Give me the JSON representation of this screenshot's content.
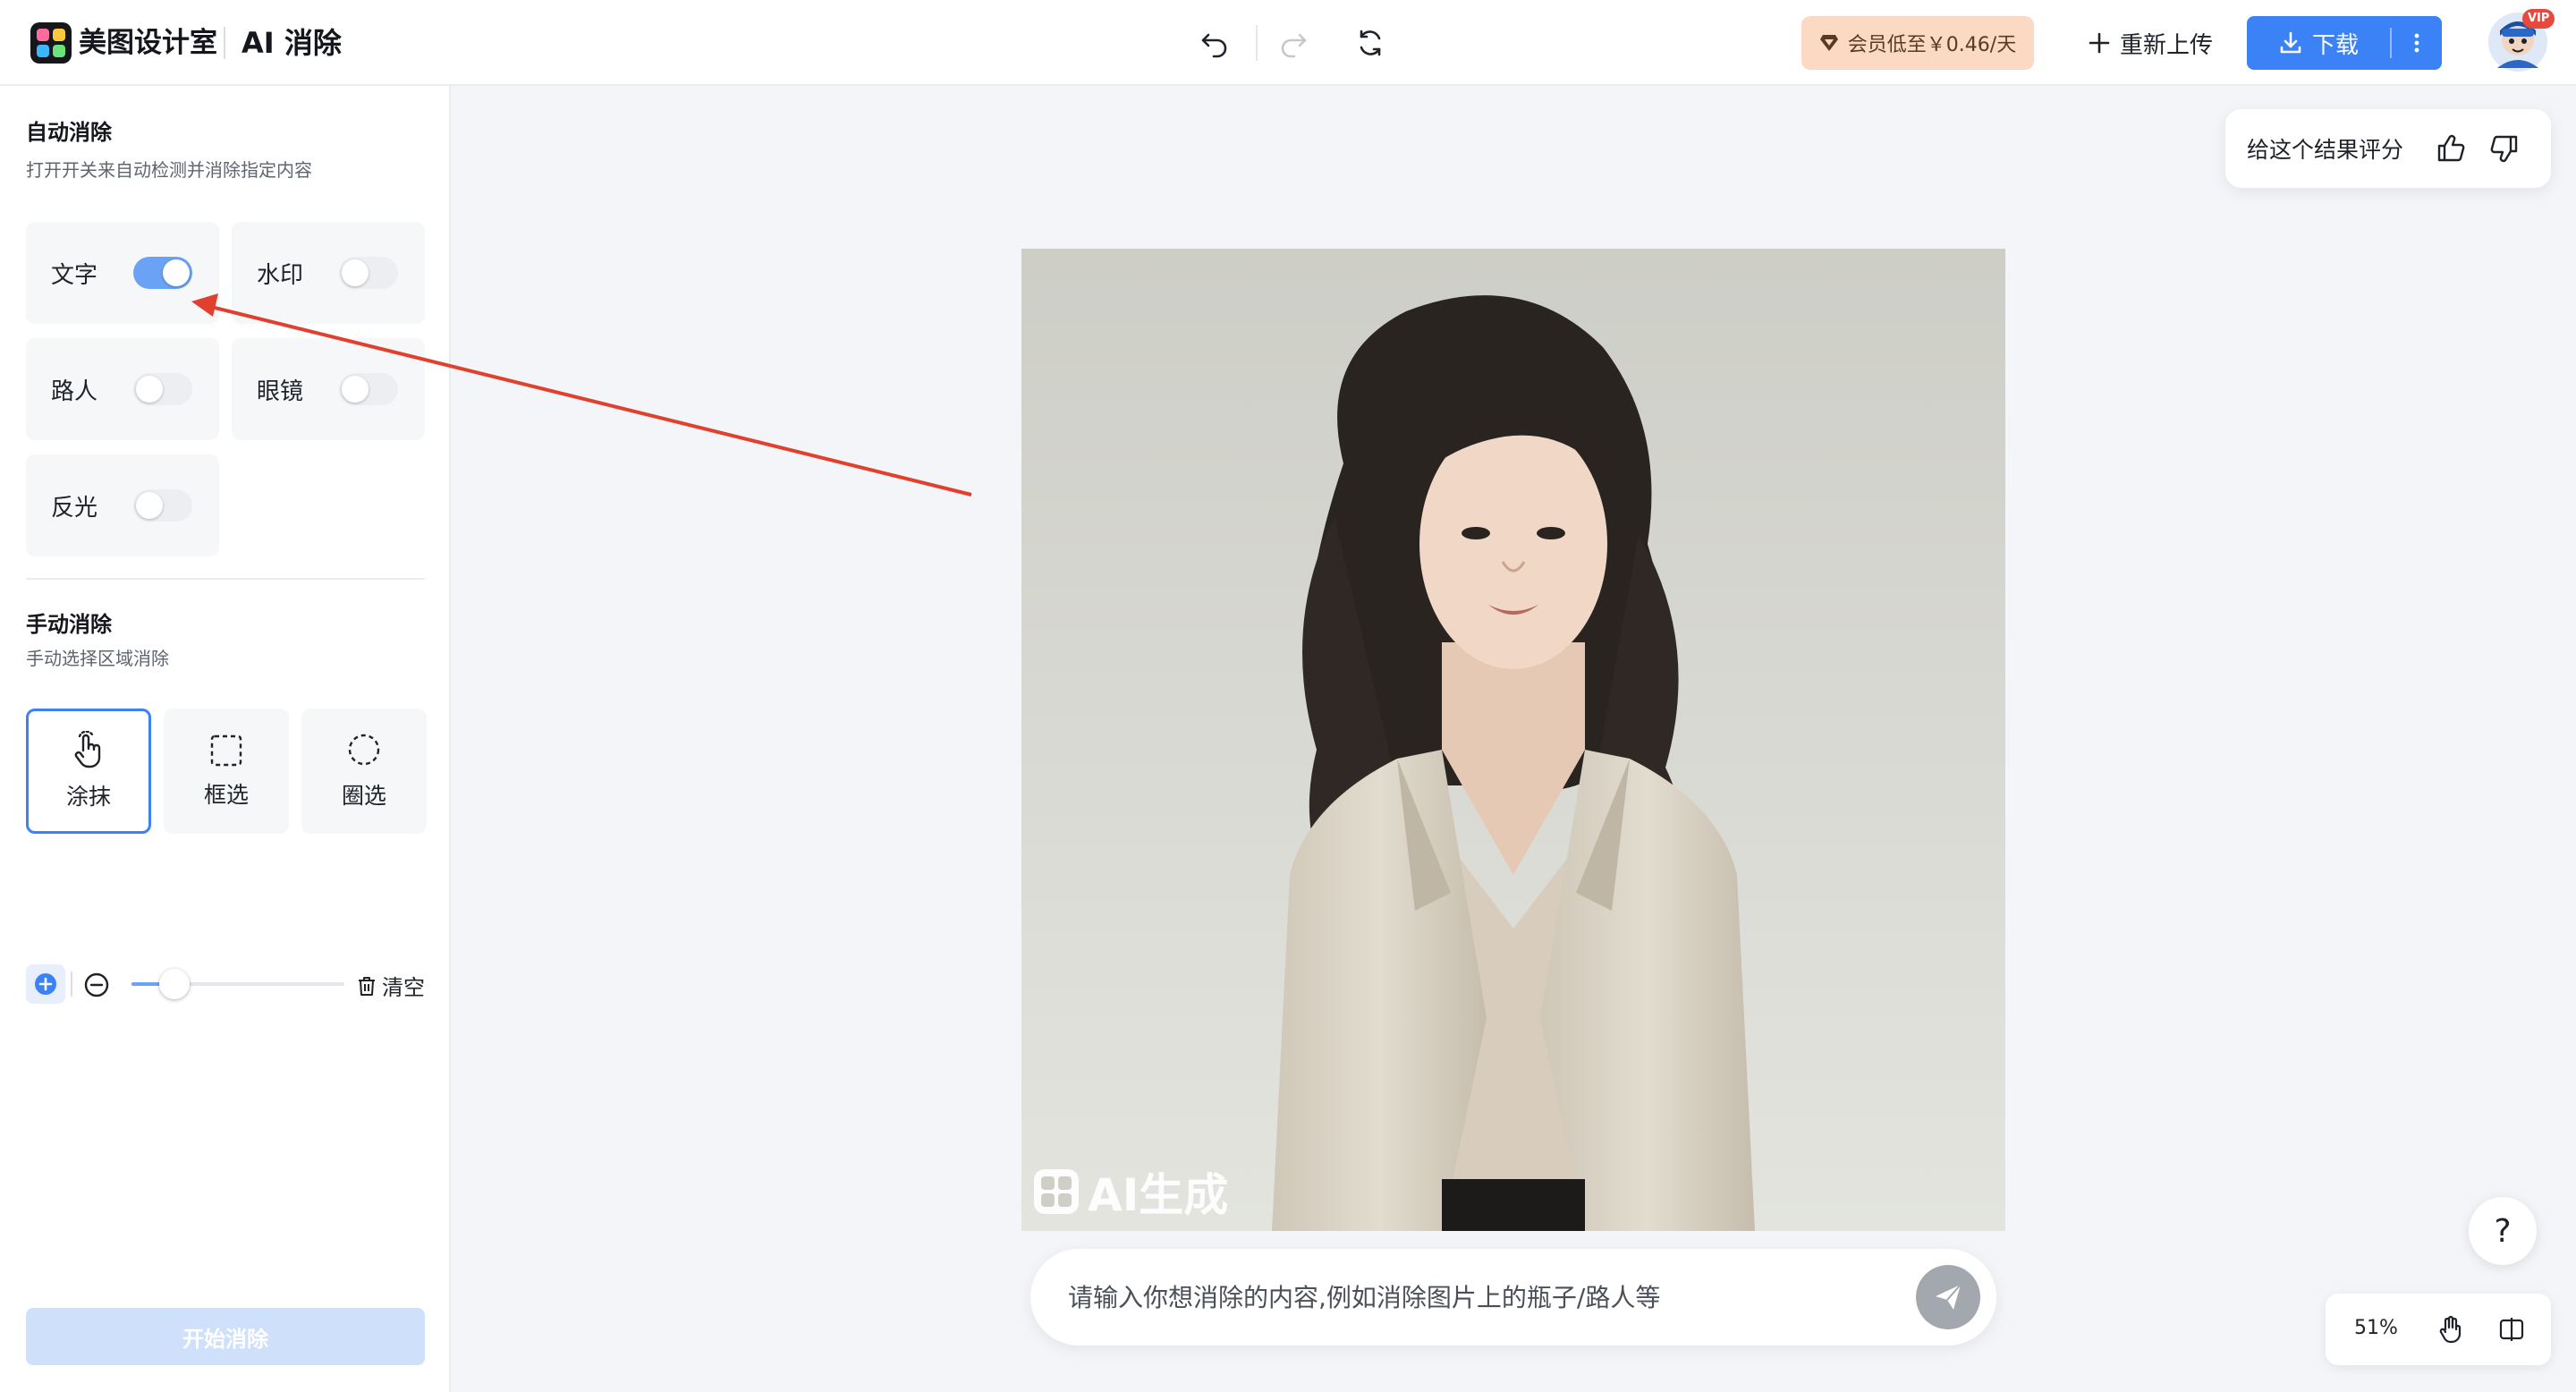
{
  "header": {
    "brand": "美图设计室",
    "tool_title": "AI 消除",
    "vip_offer": "会员低至￥0.46/天",
    "reupload": "重新上传",
    "download": "下载",
    "vip_tag": "VIP"
  },
  "sidebar": {
    "auto": {
      "title": "自动消除",
      "subtitle": "打开开关来自动检测并消除指定内容",
      "options": [
        {
          "label": "文字",
          "enabled": true
        },
        {
          "label": "水印",
          "enabled": false
        },
        {
          "label": "路人",
          "enabled": false
        },
        {
          "label": "眼镜",
          "enabled": false
        },
        {
          "label": "反光",
          "enabled": false
        }
      ]
    },
    "manual": {
      "title": "手动消除",
      "subtitle": "手动选择区域消除",
      "tools": [
        {
          "label": "涂抹",
          "icon": "hand-pointer-icon",
          "active": true
        },
        {
          "label": "框选",
          "icon": "rectangle-select-icon",
          "active": false
        },
        {
          "label": "圈选",
          "icon": "lasso-select-icon",
          "active": false
        }
      ],
      "brush_size_fraction": 0.2,
      "clear": "清空"
    },
    "start_button": "开始消除"
  },
  "canvas": {
    "rating_prompt": "给这个结果评分",
    "watermark": "AI生成",
    "prompt_placeholder": "请输入你想消除的内容,例如消除图片上的瓶子/路人等",
    "zoom": "51%",
    "help": "?"
  },
  "colors": {
    "accent": "#3b82f6",
    "toggle_on": "#6aa2f5",
    "vip_bg": "#fbd9c3",
    "annotation_arrow": "#e0402e"
  }
}
